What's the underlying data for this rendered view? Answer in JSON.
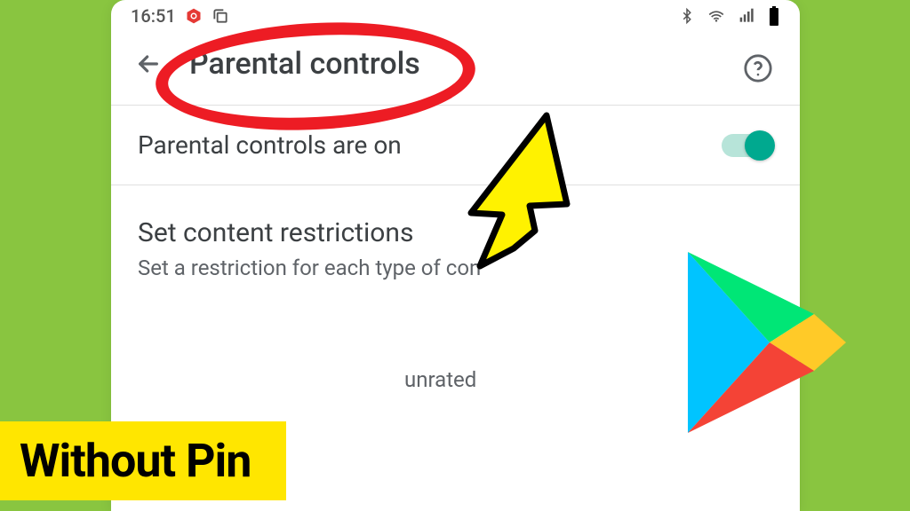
{
  "status": {
    "time": "16:51"
  },
  "toolbar": {
    "title": "Parental controls"
  },
  "toggle_row": {
    "label": "Parental controls are on"
  },
  "section": {
    "title": "Set content restrictions",
    "subtitle": "Set a restriction for each type of con"
  },
  "truncated": {
    "unrated": "unrated"
  },
  "overlay": {
    "caption": "Without Pin"
  }
}
